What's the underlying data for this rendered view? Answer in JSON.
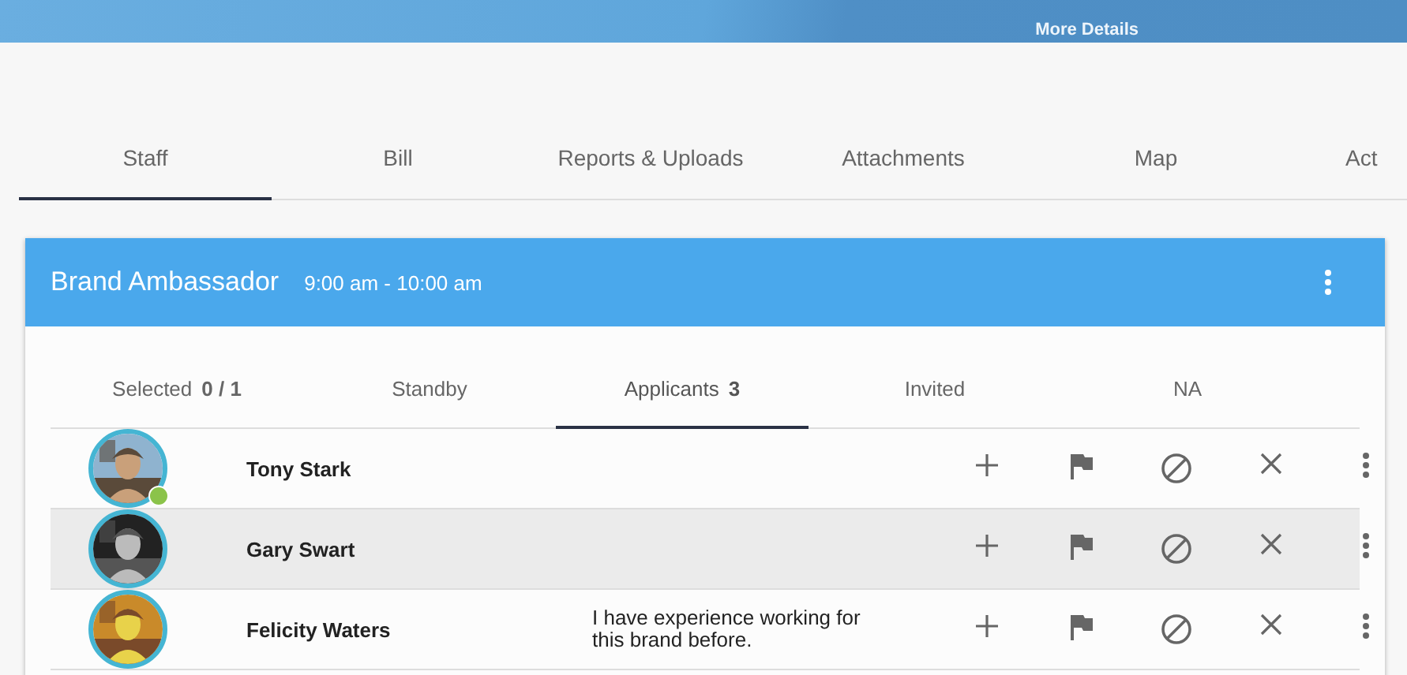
{
  "banner": {
    "link": "More Details"
  },
  "tabs": [
    {
      "label": "Staff",
      "selected": true
    },
    {
      "label": "Bill",
      "selected": false
    },
    {
      "label": "Reports & Uploads",
      "selected": false
    },
    {
      "label": "Attachments",
      "selected": false
    },
    {
      "label": "Map",
      "selected": false
    },
    {
      "label": "Act",
      "selected": false
    }
  ],
  "card": {
    "title": "Brand Ambassador",
    "time": "9:00 am - 10:00 am",
    "subtabs": [
      {
        "label": "Selected",
        "count": "0 / 1",
        "selected": false
      },
      {
        "label": "Standby",
        "selected": false
      },
      {
        "label": "Applicants",
        "count": "3",
        "selected": true
      },
      {
        "label": "Invited",
        "selected": false
      },
      {
        "label": "NA",
        "selected": false
      }
    ],
    "rows": [
      {
        "name": "Tony Stark",
        "online": true,
        "highlighted": false
      },
      {
        "name": "Gary Swart",
        "online": false,
        "highlighted": true
      },
      {
        "name": "Felicity Waters",
        "online": false,
        "highlighted": false,
        "message": "I have experience working for this brand before."
      }
    ]
  }
}
